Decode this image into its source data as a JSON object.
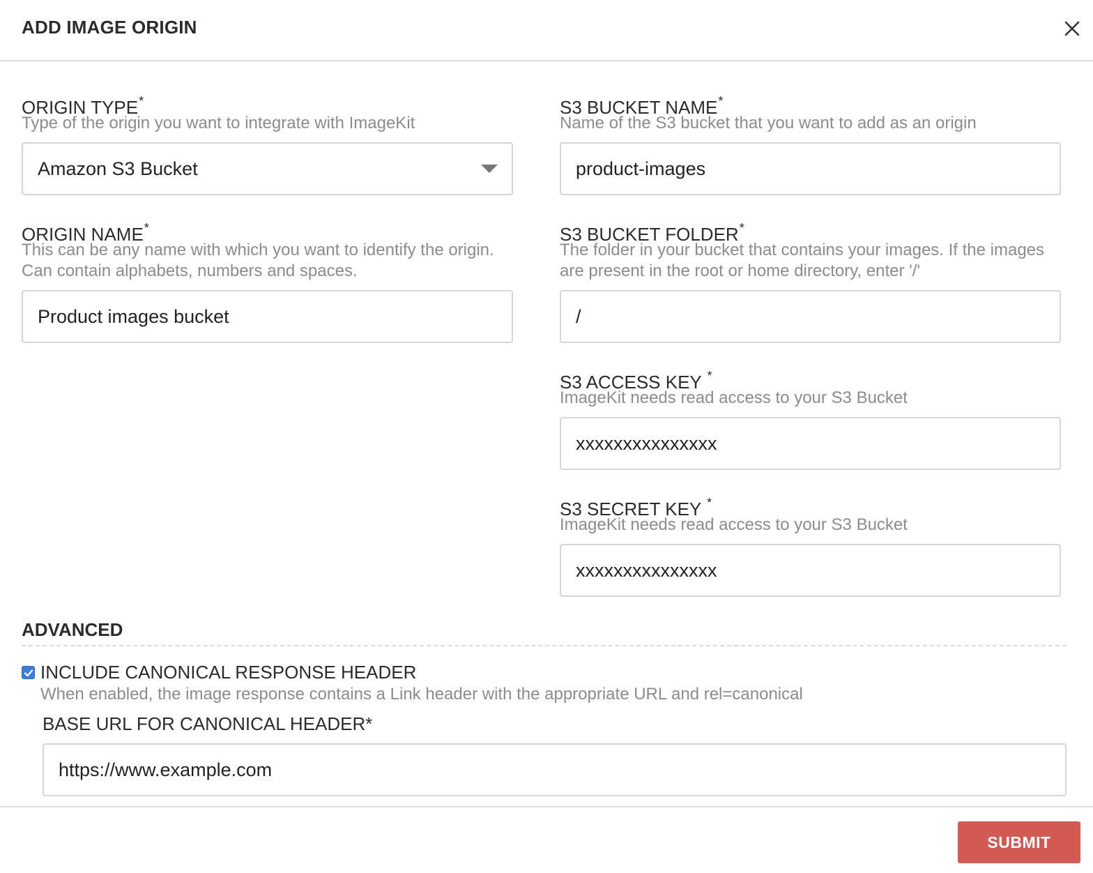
{
  "dialog": {
    "title": "ADD IMAGE ORIGIN"
  },
  "origin_type": {
    "label": "ORIGIN TYPE",
    "required_mark": "*",
    "help": "Type of the origin you want to integrate with ImageKit",
    "value": "Amazon S3 Bucket"
  },
  "origin_name": {
    "label": "ORIGIN NAME",
    "required_mark": "*",
    "help": "This can be any name with which you want to identify the origin. Can contain alphabets, numbers and spaces.",
    "value": "Product images bucket"
  },
  "s3_bucket_name": {
    "label": "S3 BUCKET NAME",
    "required_mark": "*",
    "help": "Name of the S3 bucket that you want to add as an origin",
    "value": "product-images"
  },
  "s3_bucket_folder": {
    "label": "S3 BUCKET FOLDER",
    "required_mark": "*",
    "help": "The folder in your bucket that contains your images. If the images are present in the root or home directory, enter '/'",
    "value": "/"
  },
  "s3_access_key": {
    "label": "S3 ACCESS KEY ",
    "required_mark": "*",
    "help": "ImageKit needs read access to your S3 Bucket",
    "value": "xxxxxxxxxxxxxxx"
  },
  "s3_secret_key": {
    "label": "S3 SECRET KEY ",
    "required_mark": "*",
    "help": "ImageKit needs read access to your S3 Bucket",
    "value": "xxxxxxxxxxxxxxx"
  },
  "advanced": {
    "title": "ADVANCED",
    "canonical_checkbox": {
      "checked": true,
      "label": "INCLUDE CANONICAL RESPONSE HEADER",
      "help": "When enabled, the image response contains a Link header with the appropriate URL and rel=canonical"
    },
    "base_url": {
      "label": "BASE URL FOR CANONICAL HEADER*",
      "value": "https://www.example.com"
    }
  },
  "footer": {
    "submit_label": "SUBMIT"
  },
  "colors": {
    "submit_bg": "#d35a53",
    "checkbox_accent": "#3b7ddd"
  }
}
